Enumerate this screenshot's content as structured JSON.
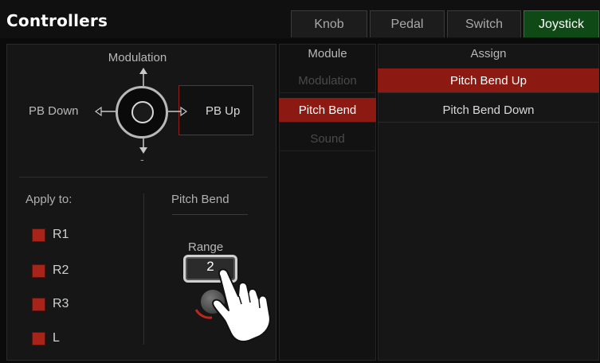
{
  "header": {
    "title": "Controllers",
    "tabs": [
      {
        "label": "Knob",
        "active": false
      },
      {
        "label": "Pedal",
        "active": false
      },
      {
        "label": "Switch",
        "active": false
      },
      {
        "label": "Joystick",
        "active": true
      }
    ]
  },
  "joystick": {
    "up_label": "Modulation",
    "left_label": "PB Down",
    "right_label": "PB Up",
    "down_label": "-"
  },
  "apply_to": {
    "label": "Apply to:",
    "parts": [
      {
        "label": "R1",
        "checked": true
      },
      {
        "label": "R2",
        "checked": true
      },
      {
        "label": "R3",
        "checked": true
      },
      {
        "label": "L",
        "checked": true
      }
    ]
  },
  "pitch_bend": {
    "heading": "Pitch Bend",
    "range_label": "Range",
    "range_value": "2"
  },
  "module_list": {
    "header": "Module",
    "items": [
      {
        "label": "Modulation",
        "state": "disabled"
      },
      {
        "label": "Pitch Bend",
        "state": "selected"
      },
      {
        "label": "Sound",
        "state": "disabled"
      }
    ]
  },
  "assign_list": {
    "header": "Assign",
    "items": [
      {
        "label": "Pitch Bend Up",
        "selected": true
      },
      {
        "label": "Pitch Bend Down",
        "selected": false
      }
    ]
  },
  "colors": {
    "accent_red": "#8d1a12",
    "active_tab_green": "#0f4a16",
    "checkbox_red": "#a82318"
  },
  "icons": [
    "arrow-up-icon",
    "arrow-down-icon",
    "arrow-left-icon",
    "arrow-right-icon",
    "hand-pointer-icon",
    "knob-icon"
  ]
}
